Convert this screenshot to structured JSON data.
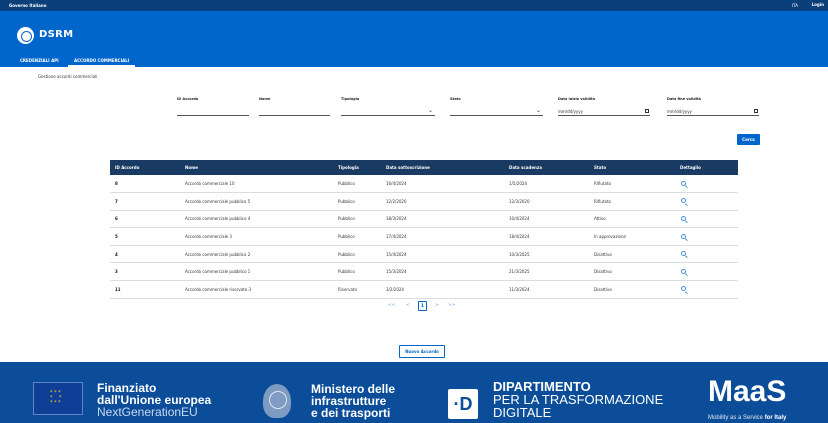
{
  "topbar": {
    "organization": "Governo Italiano",
    "language": "ITA",
    "login": "Login"
  },
  "header": {
    "app_name": "DSRM",
    "logo_icon": "republic-emblem-icon"
  },
  "tabs": [
    {
      "label": "CREDENZIALI API",
      "active": false
    },
    {
      "label": "ACCORDO COMMERCIALI",
      "active": true
    }
  ],
  "page": {
    "section_title": "Gestione accordi commerciali"
  },
  "filters": {
    "id_accordo": {
      "label": "ID Accordo",
      "value": ""
    },
    "nome": {
      "label": "Nome",
      "value": ""
    },
    "tipologia": {
      "label": "Tipologia",
      "value": ""
    },
    "stato": {
      "label": "Stato",
      "value": ""
    },
    "data_inizio": {
      "label": "Data inizio validità",
      "placeholder": "mm/dd/yyyy"
    },
    "data_fine": {
      "label": "Data fine validità",
      "placeholder": "mm/dd/yyyy"
    },
    "search_button": "Cerca"
  },
  "table": {
    "headers": [
      "ID Accordo",
      "Nome",
      "Tipologia",
      "Data sottoscrizione",
      "Data scadenza",
      "Stato",
      "Dettaglio"
    ],
    "rows": [
      {
        "id": "8",
        "nome": "Accordo commerciale 10",
        "tipologia": "Pubblico",
        "sottoscrizione": "16/4/2024",
        "scadenza": "1/5/2024",
        "stato": "Rifiutato"
      },
      {
        "id": "7",
        "nome": "Accordo commerciale pubblico 5",
        "tipologia": "Pubblico",
        "sottoscrizione": "12/2/2020",
        "scadenza": "12/3/2020",
        "stato": "Rifiutato"
      },
      {
        "id": "6",
        "nome": "Accordo commerciale pubblico 4",
        "tipologia": "Pubblico",
        "sottoscrizione": "18/3/2024",
        "scadenza": "10/4/2024",
        "stato": "Attivo"
      },
      {
        "id": "5",
        "nome": "Accordo commerciale 3",
        "tipologia": "Pubblico",
        "sottoscrizione": "17/4/2024",
        "scadenza": "18/4/2024",
        "stato": "In approvazione"
      },
      {
        "id": "4",
        "nome": "Accordo commerciale pubblico 2",
        "tipologia": "Pubblico",
        "sottoscrizione": "15/4/2024",
        "scadenza": "10/3/2025",
        "stato": "Disattivo"
      },
      {
        "id": "3",
        "nome": "Accordo commerciale pubblico 1",
        "tipologia": "Pubblico",
        "sottoscrizione": "15/3/2024",
        "scadenza": "21/3/2025",
        "stato": "Disattivo"
      },
      {
        "id": "11",
        "nome": "Accordo commerciale riservato 3",
        "tipologia": "Riservato",
        "sottoscrizione": "3/2/2024",
        "scadenza": "11/3/2024",
        "stato": "Disattivo"
      }
    ],
    "detail_icon": "search-icon"
  },
  "pagination": {
    "first": "<<",
    "prev": "<",
    "current": "1",
    "next": ">",
    "last": ">>"
  },
  "actions": {
    "new_button": "Nuovo Accordo"
  },
  "footer": {
    "eu": {
      "line1": "Finanziato",
      "line2": "dall'Unione europea",
      "line3": "NextGenerationEU"
    },
    "ministry": {
      "line1": "Ministero delle",
      "line2": "infrastrutture",
      "line3": "e dei trasporti"
    },
    "department": {
      "badge": "·D",
      "line1": "DIPARTIMENTO",
      "line2": "PER LA TRASFORMAZIONE",
      "line3": "DIGITALE"
    },
    "maas": {
      "logo": "MaaS",
      "tagline": "Mobility as a Service ",
      "tagline_bold": "for Italy"
    }
  },
  "colors": {
    "primary": "#0066cc",
    "topbar": "#0b3f7a",
    "table_header": "#193b63",
    "footer": "#0b4d98"
  }
}
